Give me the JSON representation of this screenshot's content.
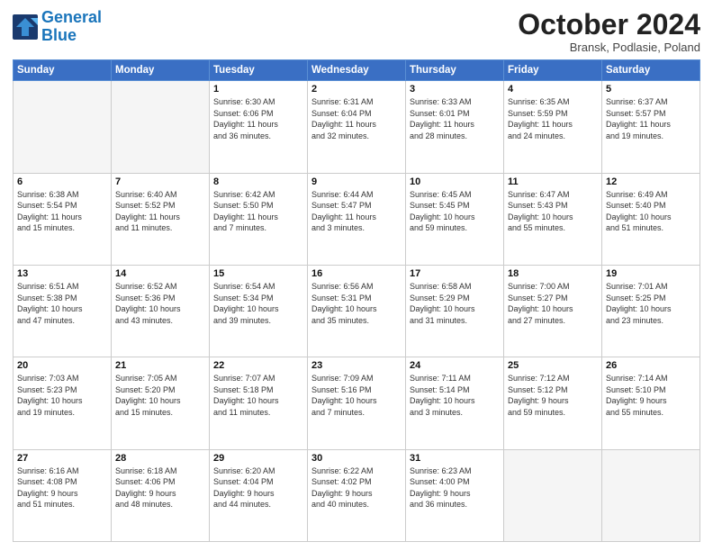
{
  "header": {
    "logo_line1": "General",
    "logo_line2": "Blue",
    "month_title": "October 2024",
    "location": "Bransk, Podlasie, Poland"
  },
  "weekdays": [
    "Sunday",
    "Monday",
    "Tuesday",
    "Wednesday",
    "Thursday",
    "Friday",
    "Saturday"
  ],
  "weeks": [
    [
      {
        "day": "",
        "info": ""
      },
      {
        "day": "",
        "info": ""
      },
      {
        "day": "1",
        "info": "Sunrise: 6:30 AM\nSunset: 6:06 PM\nDaylight: 11 hours\nand 36 minutes."
      },
      {
        "day": "2",
        "info": "Sunrise: 6:31 AM\nSunset: 6:04 PM\nDaylight: 11 hours\nand 32 minutes."
      },
      {
        "day": "3",
        "info": "Sunrise: 6:33 AM\nSunset: 6:01 PM\nDaylight: 11 hours\nand 28 minutes."
      },
      {
        "day": "4",
        "info": "Sunrise: 6:35 AM\nSunset: 5:59 PM\nDaylight: 11 hours\nand 24 minutes."
      },
      {
        "day": "5",
        "info": "Sunrise: 6:37 AM\nSunset: 5:57 PM\nDaylight: 11 hours\nand 19 minutes."
      }
    ],
    [
      {
        "day": "6",
        "info": "Sunrise: 6:38 AM\nSunset: 5:54 PM\nDaylight: 11 hours\nand 15 minutes."
      },
      {
        "day": "7",
        "info": "Sunrise: 6:40 AM\nSunset: 5:52 PM\nDaylight: 11 hours\nand 11 minutes."
      },
      {
        "day": "8",
        "info": "Sunrise: 6:42 AM\nSunset: 5:50 PM\nDaylight: 11 hours\nand 7 minutes."
      },
      {
        "day": "9",
        "info": "Sunrise: 6:44 AM\nSunset: 5:47 PM\nDaylight: 11 hours\nand 3 minutes."
      },
      {
        "day": "10",
        "info": "Sunrise: 6:45 AM\nSunset: 5:45 PM\nDaylight: 10 hours\nand 59 minutes."
      },
      {
        "day": "11",
        "info": "Sunrise: 6:47 AM\nSunset: 5:43 PM\nDaylight: 10 hours\nand 55 minutes."
      },
      {
        "day": "12",
        "info": "Sunrise: 6:49 AM\nSunset: 5:40 PM\nDaylight: 10 hours\nand 51 minutes."
      }
    ],
    [
      {
        "day": "13",
        "info": "Sunrise: 6:51 AM\nSunset: 5:38 PM\nDaylight: 10 hours\nand 47 minutes."
      },
      {
        "day": "14",
        "info": "Sunrise: 6:52 AM\nSunset: 5:36 PM\nDaylight: 10 hours\nand 43 minutes."
      },
      {
        "day": "15",
        "info": "Sunrise: 6:54 AM\nSunset: 5:34 PM\nDaylight: 10 hours\nand 39 minutes."
      },
      {
        "day": "16",
        "info": "Sunrise: 6:56 AM\nSunset: 5:31 PM\nDaylight: 10 hours\nand 35 minutes."
      },
      {
        "day": "17",
        "info": "Sunrise: 6:58 AM\nSunset: 5:29 PM\nDaylight: 10 hours\nand 31 minutes."
      },
      {
        "day": "18",
        "info": "Sunrise: 7:00 AM\nSunset: 5:27 PM\nDaylight: 10 hours\nand 27 minutes."
      },
      {
        "day": "19",
        "info": "Sunrise: 7:01 AM\nSunset: 5:25 PM\nDaylight: 10 hours\nand 23 minutes."
      }
    ],
    [
      {
        "day": "20",
        "info": "Sunrise: 7:03 AM\nSunset: 5:23 PM\nDaylight: 10 hours\nand 19 minutes."
      },
      {
        "day": "21",
        "info": "Sunrise: 7:05 AM\nSunset: 5:20 PM\nDaylight: 10 hours\nand 15 minutes."
      },
      {
        "day": "22",
        "info": "Sunrise: 7:07 AM\nSunset: 5:18 PM\nDaylight: 10 hours\nand 11 minutes."
      },
      {
        "day": "23",
        "info": "Sunrise: 7:09 AM\nSunset: 5:16 PM\nDaylight: 10 hours\nand 7 minutes."
      },
      {
        "day": "24",
        "info": "Sunrise: 7:11 AM\nSunset: 5:14 PM\nDaylight: 10 hours\nand 3 minutes."
      },
      {
        "day": "25",
        "info": "Sunrise: 7:12 AM\nSunset: 5:12 PM\nDaylight: 9 hours\nand 59 minutes."
      },
      {
        "day": "26",
        "info": "Sunrise: 7:14 AM\nSunset: 5:10 PM\nDaylight: 9 hours\nand 55 minutes."
      }
    ],
    [
      {
        "day": "27",
        "info": "Sunrise: 6:16 AM\nSunset: 4:08 PM\nDaylight: 9 hours\nand 51 minutes."
      },
      {
        "day": "28",
        "info": "Sunrise: 6:18 AM\nSunset: 4:06 PM\nDaylight: 9 hours\nand 48 minutes."
      },
      {
        "day": "29",
        "info": "Sunrise: 6:20 AM\nSunset: 4:04 PM\nDaylight: 9 hours\nand 44 minutes."
      },
      {
        "day": "30",
        "info": "Sunrise: 6:22 AM\nSunset: 4:02 PM\nDaylight: 9 hours\nand 40 minutes."
      },
      {
        "day": "31",
        "info": "Sunrise: 6:23 AM\nSunset: 4:00 PM\nDaylight: 9 hours\nand 36 minutes."
      },
      {
        "day": "",
        "info": ""
      },
      {
        "day": "",
        "info": ""
      }
    ]
  ]
}
